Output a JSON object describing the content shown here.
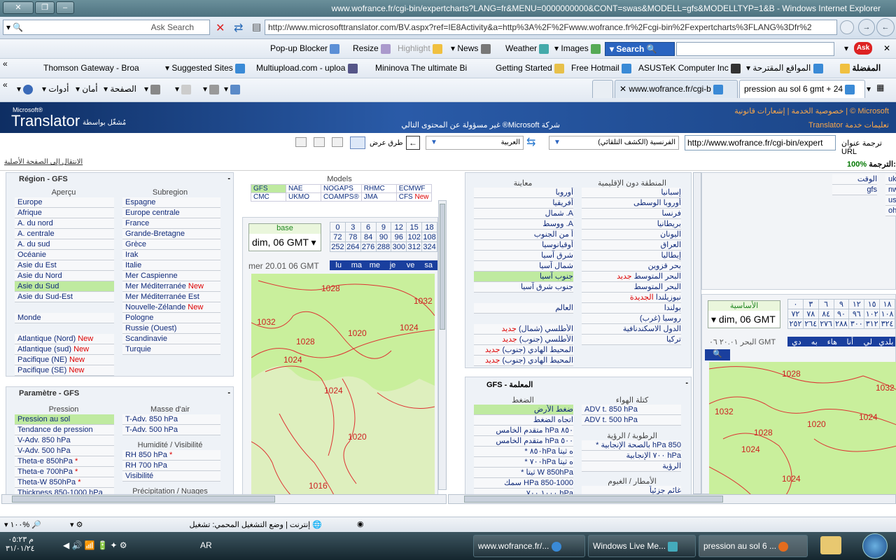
{
  "window": {
    "title": "www.wofrance.fr/cgi-bin/expertcharts?LANG=fr&MENU=0000000000&CONT=swas&MODELL=gfs&MODELLTYP=1&B - Windows Internet Explorer"
  },
  "ie": {
    "ask_search": "Ask Search",
    "url": "http://www.microsofttranslator.com/BV.aspx?ref=IE8Activity&a=http%3A%2F%2Fwww.wofrance.fr%2Fcgi-bin%2Fexpertcharts%3FLANG%3Dfr%2"
  },
  "toolbar": {
    "popup": "Pop-up Blocker",
    "resize": "Resize",
    "highlight": "Highlight",
    "news": "News",
    "weather": "Weather",
    "images": "Images",
    "search": "Search",
    "ask": "Ask"
  },
  "favorites": {
    "fav": "المفضلة",
    "suggested_ar": "المواقع المقترحة",
    "asus": "ASUSTeK Computer Inc",
    "hotmail": "Free Hotmail",
    "getting_started": "Getting Started",
    "mininova": "Mininova  The ultimate Bi",
    "multiupload": "Multiupload.com - uploa",
    "suggested": "Suggested Sites",
    "thomson": "Thomson Gateway - Broa"
  },
  "cmdbar": {
    "tools": "أدوات",
    "safety": "أمان",
    "page": "الصفحة"
  },
  "tabs": {
    "tab1": "pression au sol 6 gmt + 24",
    "tab2": "www.wofrance.fr/cgi-b"
  },
  "translator": {
    "ms": "Microsoft®",
    "brand": "Translator",
    "powered": "مُشغّل بواسطة",
    "disclaimer": "شركة Microsoft® غير مسؤولة عن المحتوى التالي",
    "links": "Microsoft ©  |  خصوصية الخدمة  |  إشعارات قانونية",
    "service": "تعليمات خدمة Translator",
    "url_label": "ترجمة عنوان URL",
    "url_value": "http://www.wofrance.fr/cgi-bin/expert",
    "from": "(الفرنسية (الكشف التلقائي",
    "to": "العربية",
    "view": "طرق عرض",
    "progress_label": "الترجمة:",
    "progress": "100%",
    "back": "الانتقال إلى الصفحة الأصلية"
  },
  "left": {
    "region_title": "Région - GFS",
    "apercu": "Aperçu",
    "subregion": "Subregion",
    "apercu_items": [
      "Europe",
      "Afrique",
      "A. du nord",
      "A. centrale",
      "A. du sud",
      "Océanie",
      "Asie du Est",
      "Asie du Nord",
      "Asie du Sud",
      "Asie du Sud-Est",
      "",
      "Monde",
      "",
      "Atlantique (Nord)",
      "Atlantique (sud)",
      "Pacifique (NE)",
      "Pacifique (SE)"
    ],
    "apercu_new": [
      "",
      "",
      "",
      "",
      "",
      "",
      "",
      "",
      "",
      "",
      "",
      "",
      "",
      "New",
      "New",
      "New",
      "New"
    ],
    "sub_items": [
      "Espagne",
      "Europe centrale",
      "France",
      "Grande-Bretagne",
      "Grèce",
      "Irak",
      "Italie",
      "Mer Caspienne",
      "Mer Méditerranée",
      "Mer Méditerranée Est",
      "Nouvelle-Zélande",
      "Pologne",
      "Russie (Ouest)",
      "Scandinavie",
      "Turquie"
    ],
    "sub_new": [
      "",
      "",
      "",
      "",
      "",
      "",
      "",
      "",
      "New",
      "",
      "New",
      "",
      "",
      "",
      ""
    ],
    "param_title": "Paramètre - GFS",
    "pression": "Pression",
    "masse": "Masse d'air",
    "humid": "Humidité / Visibilité",
    "precip": "Précipitation / Nuages",
    "pression_items": [
      "Pression au sol",
      "Tendance de pression",
      "V-Adv. 850 hPa",
      "V-Adv. 500 hPa",
      "Theta-e 850hPa",
      "Theta-e 700hPa",
      "Theta-W 850hPa",
      "Thickness 850-1000 hPa"
    ],
    "pression_star": [
      "",
      "",
      "",
      "",
      "*",
      "*",
      "*",
      ""
    ],
    "masse_items": [
      "T-Adv. 850 hPa",
      "T-Adv. 500 hPa"
    ],
    "humid_items": [
      "RH 850 hPa",
      "RH 700 hPa",
      "Visibilité"
    ],
    "humid_star": [
      "*",
      "",
      ""
    ]
  },
  "models": {
    "title": "Models",
    "row1": [
      "GFS",
      "NAE",
      "NOGAPS",
      "RHMC",
      "ECMWF"
    ],
    "row2": [
      "CMC",
      "UKMO",
      "COAMPS®",
      "JMA",
      "CFS"
    ],
    "new": "New"
  },
  "chart": {
    "base": "base",
    "time": "dim, 06 GMT",
    "hours1": [
      "0",
      "3",
      "6",
      "9",
      "12",
      "15",
      "18"
    ],
    "hours2": [
      "72",
      "78",
      "84",
      "90",
      "96",
      "102",
      "108"
    ],
    "hours3": [
      "252",
      "264",
      "276",
      "288",
      "300",
      "312",
      "324"
    ],
    "date": "mer 20.01 06 GMT",
    "days": [
      "lu",
      "ma",
      "me",
      "je",
      "ve",
      "sa"
    ],
    "isobars": [
      "1028",
      "1032",
      "1024",
      "1032",
      "1028",
      "1020",
      "1024",
      "1024",
      "1020",
      "1016",
      "1028"
    ]
  },
  "ar_region": {
    "col1": "المنطقة دون الإقليمية",
    "col2": "معاينة",
    "items1": [
      "إسبانيا",
      "أوروبا الوسطى",
      "فرنسا",
      "بريطانيا",
      "اليونان",
      "العراق",
      "إيطاليا",
      "بحر قزوين",
      "البحر المتوسط",
      "البحر المتوسط",
      "نيوزيلندا",
      "بولندا",
      "روسيا (غرب)",
      "الدول الاسكندنافية",
      "تركيا"
    ],
    "new1": [
      "",
      "",
      "",
      "",
      "",
      "",
      "",
      "",
      "جديد",
      "",
      "الجديدة",
      "",
      "",
      "",
      ""
    ],
    "items2": [
      "أوروبا",
      "أفريقيا",
      "A. شمال",
      "A. ووسط",
      "أ من الجنوب",
      "أوقيانوسيا",
      "شرق آسيا",
      "شمال آسيا",
      "جنوب آسيا",
      "جنوب شرق آسيا",
      "",
      "العالم",
      "",
      "الأطلسي (شمال)",
      "الأطلسي (جنوب)",
      "المحيط الهادي (جنوب)",
      "المحيط الهادي (جنوب)"
    ],
    "new2": [
      "",
      "",
      "",
      "",
      "",
      "",
      "",
      "",
      "",
      "",
      "",
      "",
      "",
      "جديد",
      "جديد",
      "جديد",
      "جديد"
    ]
  },
  "ar_param": {
    "title": "GFS - المعلمة",
    "col1": "كتلة الهواء",
    "col2": "الضغط",
    "items1": [
      "ADV t. 850 hPa",
      "ADV t. 500 hPa"
    ],
    "hum": "الرطوبة / الرؤية",
    "hum_items": [
      "850 hPa بالصحة الإنجابية *",
      "hPa ٧٠٠ الإنجابية",
      "الرؤية"
    ],
    "precip": "الأمطار / الغيوم",
    "precip_items": [
      "غائم جزئياً"
    ],
    "items2": [
      "ضغط الأرض",
      "اتجاه الضغط",
      "٨٥٠ hPa متقدم الخامس",
      "٥٠٠ hPa متقدم الخامس",
      "ه ثيتا ٨٥٠hPa *",
      "ه ثيتا ٧٠٠hPa *",
      "W 850hPa ثيتا *",
      "HPa 850-1000 سمك",
      "hPa ١٠٠٠ ٧٠٠ ..."
    ]
  },
  "right_chart": {
    "base": "الأساسية",
    "time": "dim, 06 GMT",
    "hours1": [
      "٠",
      "٣",
      "٦",
      "٩",
      "١٢",
      "١٥",
      "١٨"
    ],
    "hours2": [
      "٧٢",
      "٧٨",
      "٨٤",
      "٩٠",
      "٩٦",
      "١٠٢",
      "١٠٨"
    ],
    "hours3": [
      "٢٥٢",
      "٢٦٤",
      "٢٧٦",
      "٢٨٨",
      "٣٠٠",
      "٣١٢",
      "٣٢٤"
    ],
    "date": "البحر ٢٠.٠١ ٠٦ GMT",
    "days": [
      "دي",
      "به",
      "هاء",
      "أنا",
      "لي",
      "بلدي"
    ],
    "isobars": [
      "1028",
      "1032",
      "1032",
      "1020",
      "1024",
      "1028",
      "1024",
      "1024"
    ]
  },
  "far_right": {
    "items": [
      "الوقت",
      "gfs"
    ],
    "codes": [
      "uk",
      "nw",
      "us",
      "oh"
    ]
  },
  "status": {
    "zone": "إنترنت | وضع التشغيل المحمي: تشغيل",
    "zoom": "١٠٠%"
  },
  "taskbar": {
    "t1": "www.wofrance.fr/...",
    "t2": "Windows Live Me...",
    "t3": "pression au sol 6 ...",
    "lang": "AR",
    "time": "م ٠٥:٢٣",
    "date": "٣١/٠١/٢٤"
  }
}
